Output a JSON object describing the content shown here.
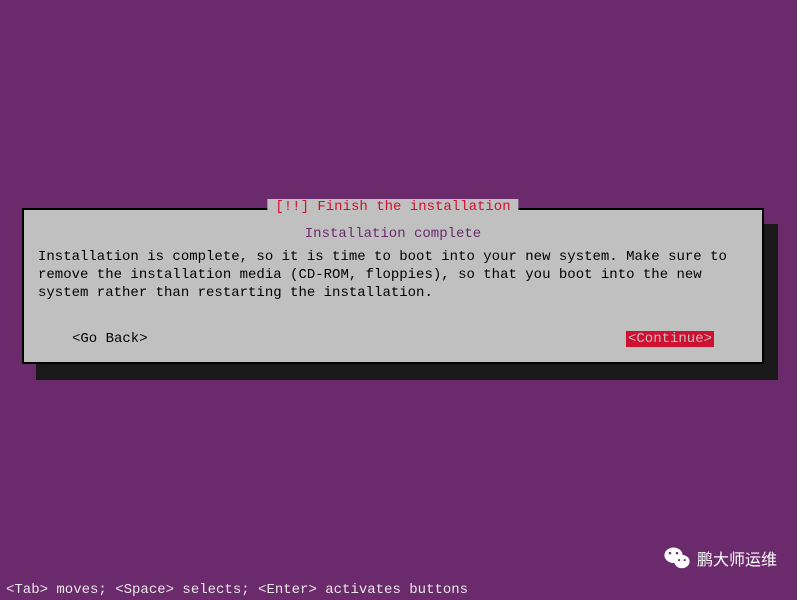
{
  "dialog": {
    "title": "[!!] Finish the installation",
    "subtitle": "Installation complete",
    "body": "Installation is complete, so it is time to boot into your new system. Make sure to remove the installation media (CD-ROM, floppies), so that you boot into the new system rather than restarting the installation.",
    "goBackLabel": "<Go Back>",
    "continueLabel": "<Continue>"
  },
  "footer": {
    "helpText": "<Tab> moves; <Space> selects; <Enter> activates buttons"
  },
  "watermark": {
    "text": "鹏大师运维"
  }
}
